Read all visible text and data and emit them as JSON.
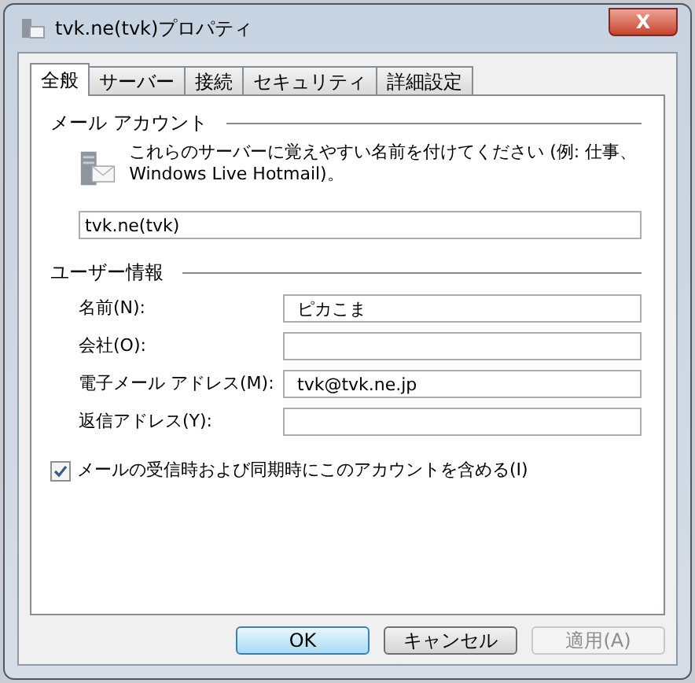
{
  "window": {
    "title": "tvk.ne(tvk)プロパティ",
    "close_label": "X"
  },
  "tabs": [
    {
      "label": "全般",
      "selected": true
    },
    {
      "label": "サーバー",
      "selected": false
    },
    {
      "label": "接続",
      "selected": false
    },
    {
      "label": "セキュリティ",
      "selected": false
    },
    {
      "label": "詳細設定",
      "selected": false
    }
  ],
  "mail_account": {
    "heading": "メール アカウント",
    "description": "これらのサーバーに覚えやすい名前を付けてください (例: 仕事、Windows Live Hotmail)。",
    "value": "tvk.ne(tvk)"
  },
  "user_info": {
    "heading": "ユーザー情報",
    "fields": [
      {
        "label": "名前(N):",
        "value": "ピカこま"
      },
      {
        "label": "会社(O):"
      },
      {
        "label": "電子メール アドレス(M):",
        "value": "tvk@tvk.ne.jp"
      },
      {
        "label": "返信アドレス(Y):"
      }
    ]
  },
  "include_account": {
    "label": "メールの受信時および同期時にこのアカウントを含める(I)",
    "checked": true
  },
  "buttons": [
    {
      "label": "OK",
      "kind": "default",
      "disabled": false
    },
    {
      "label": "キャンセル",
      "kind": "normal",
      "disabled": false
    },
    {
      "label": "適用(A)",
      "kind": "normal",
      "disabled": true
    }
  ]
}
